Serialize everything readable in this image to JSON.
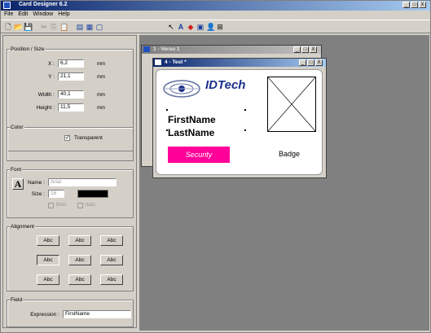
{
  "app": {
    "title": "Card Designer 6.2",
    "controls": [
      "_",
      "□",
      "X"
    ]
  },
  "menu": [
    "File",
    "Edit",
    "Window",
    "Help"
  ],
  "toolbar": {
    "icons": [
      "new-icon",
      "open-icon",
      "save-icon",
      "cut-icon",
      "copy-icon",
      "paste-icon",
      "layout-icon",
      "grid-icon",
      "frame-icon",
      "pointer-icon",
      "text-tool-icon",
      "shape-tool-icon",
      "image-tool-icon",
      "person-tool-icon",
      "barcode-tool-icon"
    ],
    "glyphs": [
      "🗋",
      "📂",
      "💾",
      "✂",
      "⎘",
      "📋",
      "▤",
      "▦",
      "▢",
      "↖",
      "A",
      "◆",
      "▣",
      "👤",
      "⊞"
    ]
  },
  "position": {
    "legend": "Position / Size",
    "x_label": "X :",
    "x_value": "6,2",
    "x_unit": "mm",
    "y_label": "Y :",
    "y_value": "21,1",
    "y_unit": "mm",
    "w_label": "Width :",
    "w_value": "40,1",
    "w_unit": "mm",
    "h_label": "Height :",
    "h_value": "11,5",
    "h_unit": "mm"
  },
  "color": {
    "legend": "Color",
    "transparent_label": "Transparent",
    "transparent_checked": true
  },
  "font": {
    "legend": "Font",
    "a_glyph": "A",
    "name_label": "Name :",
    "name_value": "Arial",
    "size_label": "Size :",
    "size_value": "16",
    "bold_label": "Bold",
    "italic_label": "Italic",
    "swatch_color": "#000000"
  },
  "alignment": {
    "legend": "Alignment",
    "cells": [
      "Abc",
      "Abc",
      "Abc",
      "Abc",
      "Abc",
      "Abc",
      "Abc",
      "Abc",
      "Abc"
    ]
  },
  "field": {
    "legend": "Field",
    "expr_label": "Expression :",
    "expr_value": "FirstName"
  },
  "windows": {
    "back_title": "1 - Verso 1",
    "front_title": "4 - Test *"
  },
  "card": {
    "logo_text": "IDTech",
    "first_name": "FirstName",
    "last_name": "LastName",
    "security": "Security",
    "badge": "Badge",
    "accent": "#ff0099",
    "logo_color": "#1a2f8a"
  }
}
